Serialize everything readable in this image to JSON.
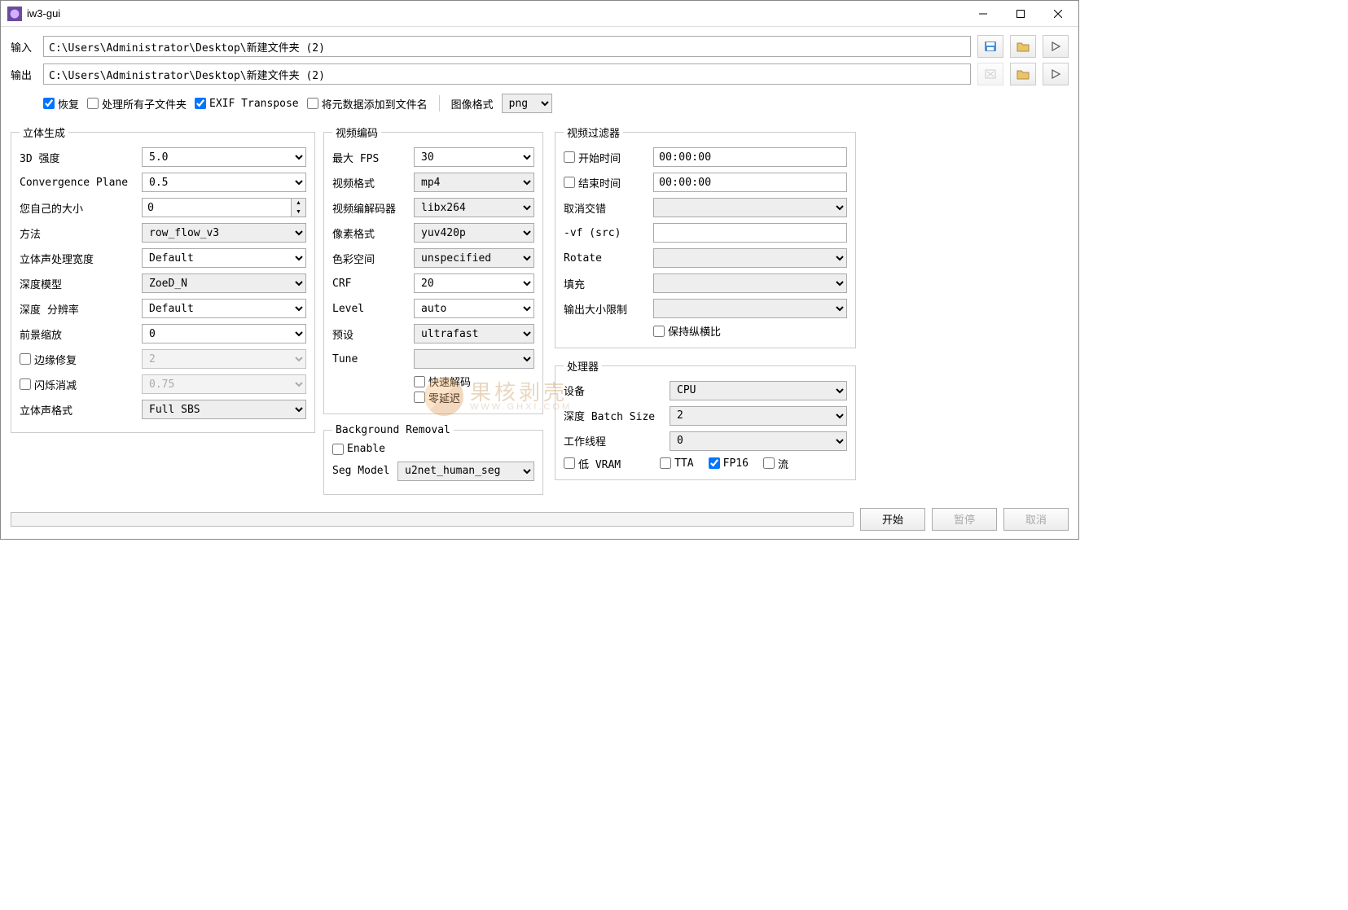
{
  "window": {
    "title": "iw3-gui"
  },
  "io": {
    "input_label": "输入",
    "input_value": "C:\\Users\\Administrator\\Desktop\\新建文件夹 (2)",
    "output_label": "输出",
    "output_value": "C:\\Users\\Administrator\\Desktop\\新建文件夹 (2)"
  },
  "opts": {
    "restore": "恢复",
    "process_sub": "处理所有子文件夹",
    "exif": "EXIF Transpose",
    "meta_fname": "将元数据添加到文件名",
    "img_fmt_label": "图像格式",
    "img_fmt_value": "png"
  },
  "stereo": {
    "legend": "立体生成",
    "strength_label": "3D 强度",
    "strength_value": "5.0",
    "conv_label": "Convergence Plane",
    "conv_value": "0.5",
    "own_label": "您自己的大小",
    "own_value": "0",
    "method_label": "方法",
    "method_value": "row_flow_v3",
    "width_label": "立体声处理宽度",
    "width_value": "Default",
    "depth_model_label": "深度模型",
    "depth_model_value": "ZoeD_N",
    "depth_res_label": "深度 分辨率",
    "depth_res_value": "Default",
    "fg_label": "前景缩放",
    "fg_value": "0",
    "edge_label": "边缘修复",
    "edge_value": "2",
    "flicker_label": "闪烁消减",
    "flicker_value": "0.75",
    "fmt_label": "立体声格式",
    "fmt_value": "Full SBS"
  },
  "venc": {
    "legend": "视频编码",
    "fps_label": "最大 FPS",
    "fps_value": "30",
    "vfmt_label": "视频格式",
    "vfmt_value": "mp4",
    "codec_label": "视频编解码器",
    "codec_value": "libx264",
    "pix_label": "像素格式",
    "pix_value": "yuv420p",
    "cspace_label": "色彩空间",
    "cspace_value": "unspecified",
    "crf_label": "CRF",
    "crf_value": "20",
    "level_label": "Level",
    "level_value": "auto",
    "preset_label": "预设",
    "preset_value": "ultrafast",
    "tune_label": "Tune",
    "tune_value": "",
    "fast_decode": "快速解码",
    "zero_lat": "零延迟"
  },
  "bgr": {
    "legend": "Background Removal",
    "enable": "Enable",
    "seg_label": "Seg Model",
    "seg_value": "u2net_human_seg"
  },
  "vfilt": {
    "legend": "视频过滤器",
    "start_label": "开始时间",
    "start_value": "00:00:00",
    "end_label": "结束时间",
    "end_value": "00:00:00",
    "deint_label": "取消交错",
    "vf_label": "-vf (src)",
    "rotate_label": "Rotate",
    "pad_label": "填充",
    "outlimit_label": "输出大小限制",
    "keep_ar": "保持纵横比"
  },
  "proc": {
    "legend": "处理器",
    "device_label": "设备",
    "device_value": "CPU",
    "batch_label": "深度 Batch Size",
    "batch_value": "2",
    "threads_label": "工作线程",
    "threads_value": "0",
    "low_vram": "低 VRAM",
    "tta": "TTA",
    "fp16": "FP16",
    "stream": "流"
  },
  "bottom": {
    "start": "开始",
    "pause": "暂停",
    "cancel": "取消"
  },
  "watermark": {
    "cn": "果核剥壳",
    "en": "WWW.GHXI.COM"
  }
}
